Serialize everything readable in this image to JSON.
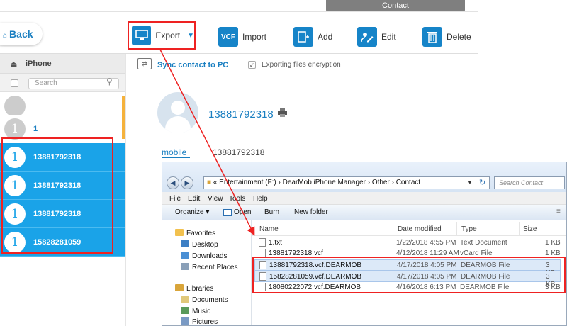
{
  "contact_tab": "Contact",
  "back": {
    "label": "Back",
    "icon": "home-icon"
  },
  "toolbar": {
    "export": "Export",
    "import": "Import",
    "import_badge": "VCF",
    "add": "Add",
    "edit": "Edit",
    "delete": "Delete"
  },
  "sidebar": {
    "device": "iPhone",
    "search_placeholder": "Search",
    "contacts": [
      {
        "initial": "",
        "name": "",
        "selected": false
      },
      {
        "initial": "1",
        "name": "1",
        "selected": false
      },
      {
        "initial": "1",
        "name": "13881792318",
        "selected": true
      },
      {
        "initial": "1",
        "name": "13881792318",
        "selected": true
      },
      {
        "initial": "1",
        "name": "13881792318",
        "selected": true
      },
      {
        "initial": "1",
        "name": "15828281059",
        "selected": true
      }
    ]
  },
  "detail": {
    "sync_link": "Sync contact to PC",
    "encrypt_label": "Exporting files encryption",
    "phone": "13881792318",
    "mobile_label": "mobile",
    "mobile_value": "13881792318"
  },
  "explorer": {
    "address": "« Entertainment (F:) › DearMob iPhone Manager › Other › Contact",
    "search_placeholder": "Search Contact",
    "menu": [
      "File",
      "Edit",
      "View",
      "Tools",
      "Help"
    ],
    "commands": {
      "organize": "Organize ▾",
      "open": "Open",
      "burn": "Burn",
      "new_folder": "New folder"
    },
    "nav": {
      "favorites": "Favorites",
      "desktop": "Desktop",
      "downloads": "Downloads",
      "recent": "Recent Places",
      "libraries": "Libraries",
      "documents": "Documents",
      "music": "Music",
      "pictures": "Pictures"
    },
    "columns": {
      "name": "Name",
      "date": "Date modified",
      "type": "Type",
      "size": "Size"
    },
    "files": [
      {
        "name": "1.txt",
        "date": "1/22/2018 4:55 PM",
        "type": "Text Document",
        "size": "1 KB",
        "highlight": false
      },
      {
        "name": "13881792318.vcf",
        "date": "4/12/2018 11:29 AM",
        "type": "vCard File",
        "size": "1 KB",
        "highlight": false
      },
      {
        "name": "13881792318.vcf.DEARMOB",
        "date": "4/17/2018 4:05 PM",
        "type": "DEARMOB File",
        "size": "3 KB",
        "highlight": true
      },
      {
        "name": "15828281059.vcf.DEARMOB",
        "date": "4/17/2018 4:05 PM",
        "type": "DEARMOB File",
        "size": "3 KB",
        "highlight": true
      },
      {
        "name": "18080222072.vcf.DEARMOB",
        "date": "4/16/2018 6:13 PM",
        "type": "DEARMOB File",
        "size": "3 KB",
        "highlight": false
      }
    ]
  },
  "colors": {
    "accent": "#1aa3e8",
    "link": "#1a7fc1",
    "annotation": "#ee2222"
  }
}
